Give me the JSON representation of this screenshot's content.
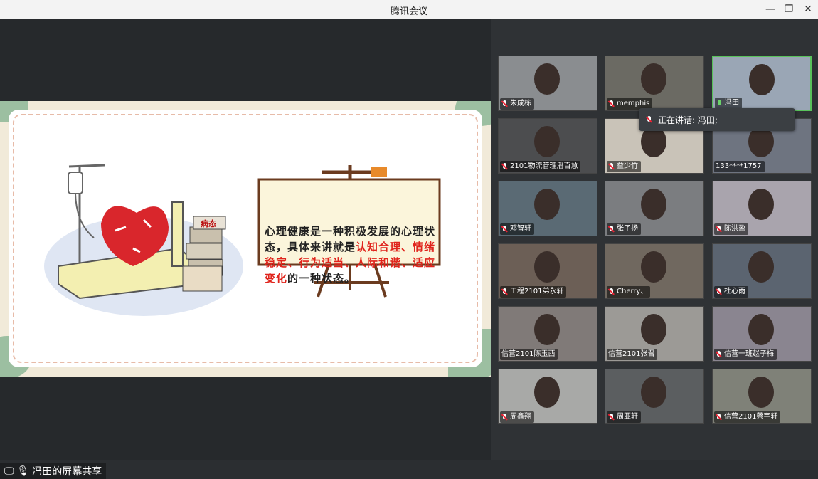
{
  "window": {
    "title": "腾讯会议"
  },
  "slide": {
    "board_text_plain_1": "心理健康是一种积极发展的心理状态，具体来讲就是",
    "board_text_red": "认知合理、情绪稳定、行为适当、人际和谐、适应变化",
    "board_text_plain_2": "的一种状态。",
    "book_label": "病态"
  },
  "share_status": "冯田的屏幕共享",
  "speaking": {
    "label": "正在讲话: 冯田;"
  },
  "participants": [
    {
      "name": "朱成栋",
      "mic": "muted"
    },
    {
      "name": "memphis",
      "mic": "muted"
    },
    {
      "name": "冯田",
      "mic": "on"
    },
    {
      "name": "2101物流管理潘百慧",
      "mic": "muted"
    },
    {
      "name": "益少竹",
      "mic": "muted"
    },
    {
      "name": "133****1757",
      "mic": "none"
    },
    {
      "name": "邓智轩",
      "mic": "muted"
    },
    {
      "name": "张了扬",
      "mic": "muted"
    },
    {
      "name": "陈洪盈",
      "mic": "muted"
    },
    {
      "name": "工程2101弟永轩",
      "mic": "muted"
    },
    {
      "name": "Cherry、",
      "mic": "muted"
    },
    {
      "name": "杜心雨",
      "mic": "muted"
    },
    {
      "name": "信营2101陈玉西",
      "mic": "none"
    },
    {
      "name": "信营2101张晋",
      "mic": "none"
    },
    {
      "name": "信营一班赵子梅",
      "mic": "muted"
    },
    {
      "name": "周鑫翔",
      "mic": "muted"
    },
    {
      "name": "周亚轩",
      "mic": "muted"
    },
    {
      "name": "信营2101蔡宇轩",
      "mic": "muted"
    }
  ]
}
